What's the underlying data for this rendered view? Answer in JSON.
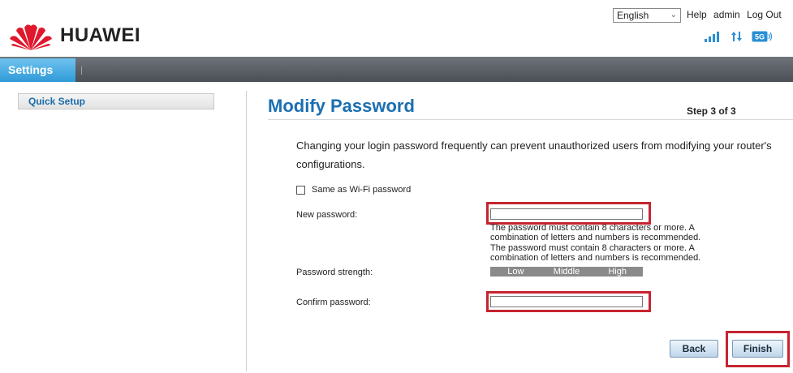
{
  "header": {
    "brand": "HUAWEI",
    "language": "English",
    "links": [
      "Help",
      "admin",
      "Log Out"
    ],
    "network_badge": "5G"
  },
  "nav": {
    "active_tab": "Settings"
  },
  "sidebar": {
    "items": [
      {
        "label": "Quick Setup"
      }
    ]
  },
  "main": {
    "title": "Modify Password",
    "step": "Step 3 of 3",
    "description": "Changing your login password frequently can prevent unauthorized users from modifying your router's configurations.",
    "same_as_wifi_label": "Same as Wi-Fi password",
    "new_password_label": "New password:",
    "new_password_value": "",
    "hint_line1": "The password must contain 8 characters or more. A",
    "hint_line2": "combination of letters and numbers is recommended.",
    "strength_label": "Password strength:",
    "strength_levels": [
      "Low",
      "Middle",
      "High"
    ],
    "confirm_password_label": "Confirm password:",
    "confirm_password_value": "",
    "back_label": "Back",
    "finish_label": "Finish"
  },
  "colors": {
    "accent": "#1b6fb1",
    "highlight": "#c6242f",
    "nav_active": "#2f9ad8"
  }
}
